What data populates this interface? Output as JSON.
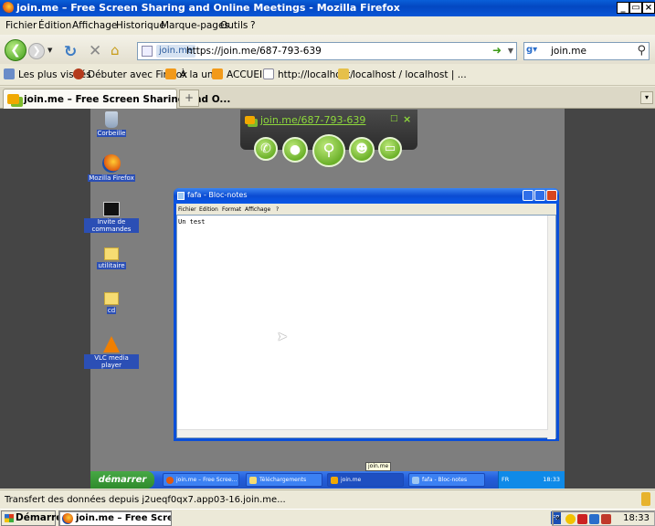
{
  "window": {
    "title": "join.me – Free Screen Sharing and Online Meetings - Mozilla Firefox",
    "min": "_",
    "max": "¸",
    "close": "×"
  },
  "menu": [
    "Fichier",
    "Édition",
    "Affichage",
    "Historique",
    "Marque-pages",
    "Outils",
    "?"
  ],
  "nav": {
    "url_identity": "join.me",
    "url": "https://join.me/687-793-639",
    "search_value": "join.me"
  },
  "bookmarks": [
    "Les plus visités",
    "Débuter avec Firefox",
    "À la une",
    "ACCUEIL",
    "http://localhost/",
    "localhost / localhost | ..."
  ],
  "tabs": [
    {
      "label": "join.me – Free Screen Sharing and O..."
    }
  ],
  "newtab": "+",
  "joinme": {
    "link": "join.me/687-793-639"
  },
  "remote": {
    "desktop_icons": [
      "Corbeille",
      "Mozilla Firefox",
      "Invite de commandes",
      "utilitaire",
      "cd",
      "VLC media player"
    ],
    "notepad": {
      "title": "fafa - Bloc-notes",
      "menu": [
        "Fichier",
        "Edition",
        "Format",
        "Affichage",
        "?"
      ],
      "text": "Un test"
    },
    "taskbar": {
      "start": "démarrer",
      "items": [
        "join.me – Free Scree...",
        "Téléchargements",
        "join.me",
        "fafa - Bloc-notes"
      ],
      "lang": "FR",
      "time": "18:33",
      "tooltip": "join.me"
    }
  },
  "status": "Transfert des données depuis j2ueqf0qx7.app03-16.join.me...",
  "host_taskbar": {
    "start": "Démarrer",
    "window": "join.me – Free Screen...",
    "lang": "FR",
    "time": "18:33"
  },
  "colors": {
    "xp_blue": "#0a4bd2",
    "joinme_green": "#7dba2c",
    "remote_bg": "#7e7e7e",
    "letterbox": "#454545"
  }
}
